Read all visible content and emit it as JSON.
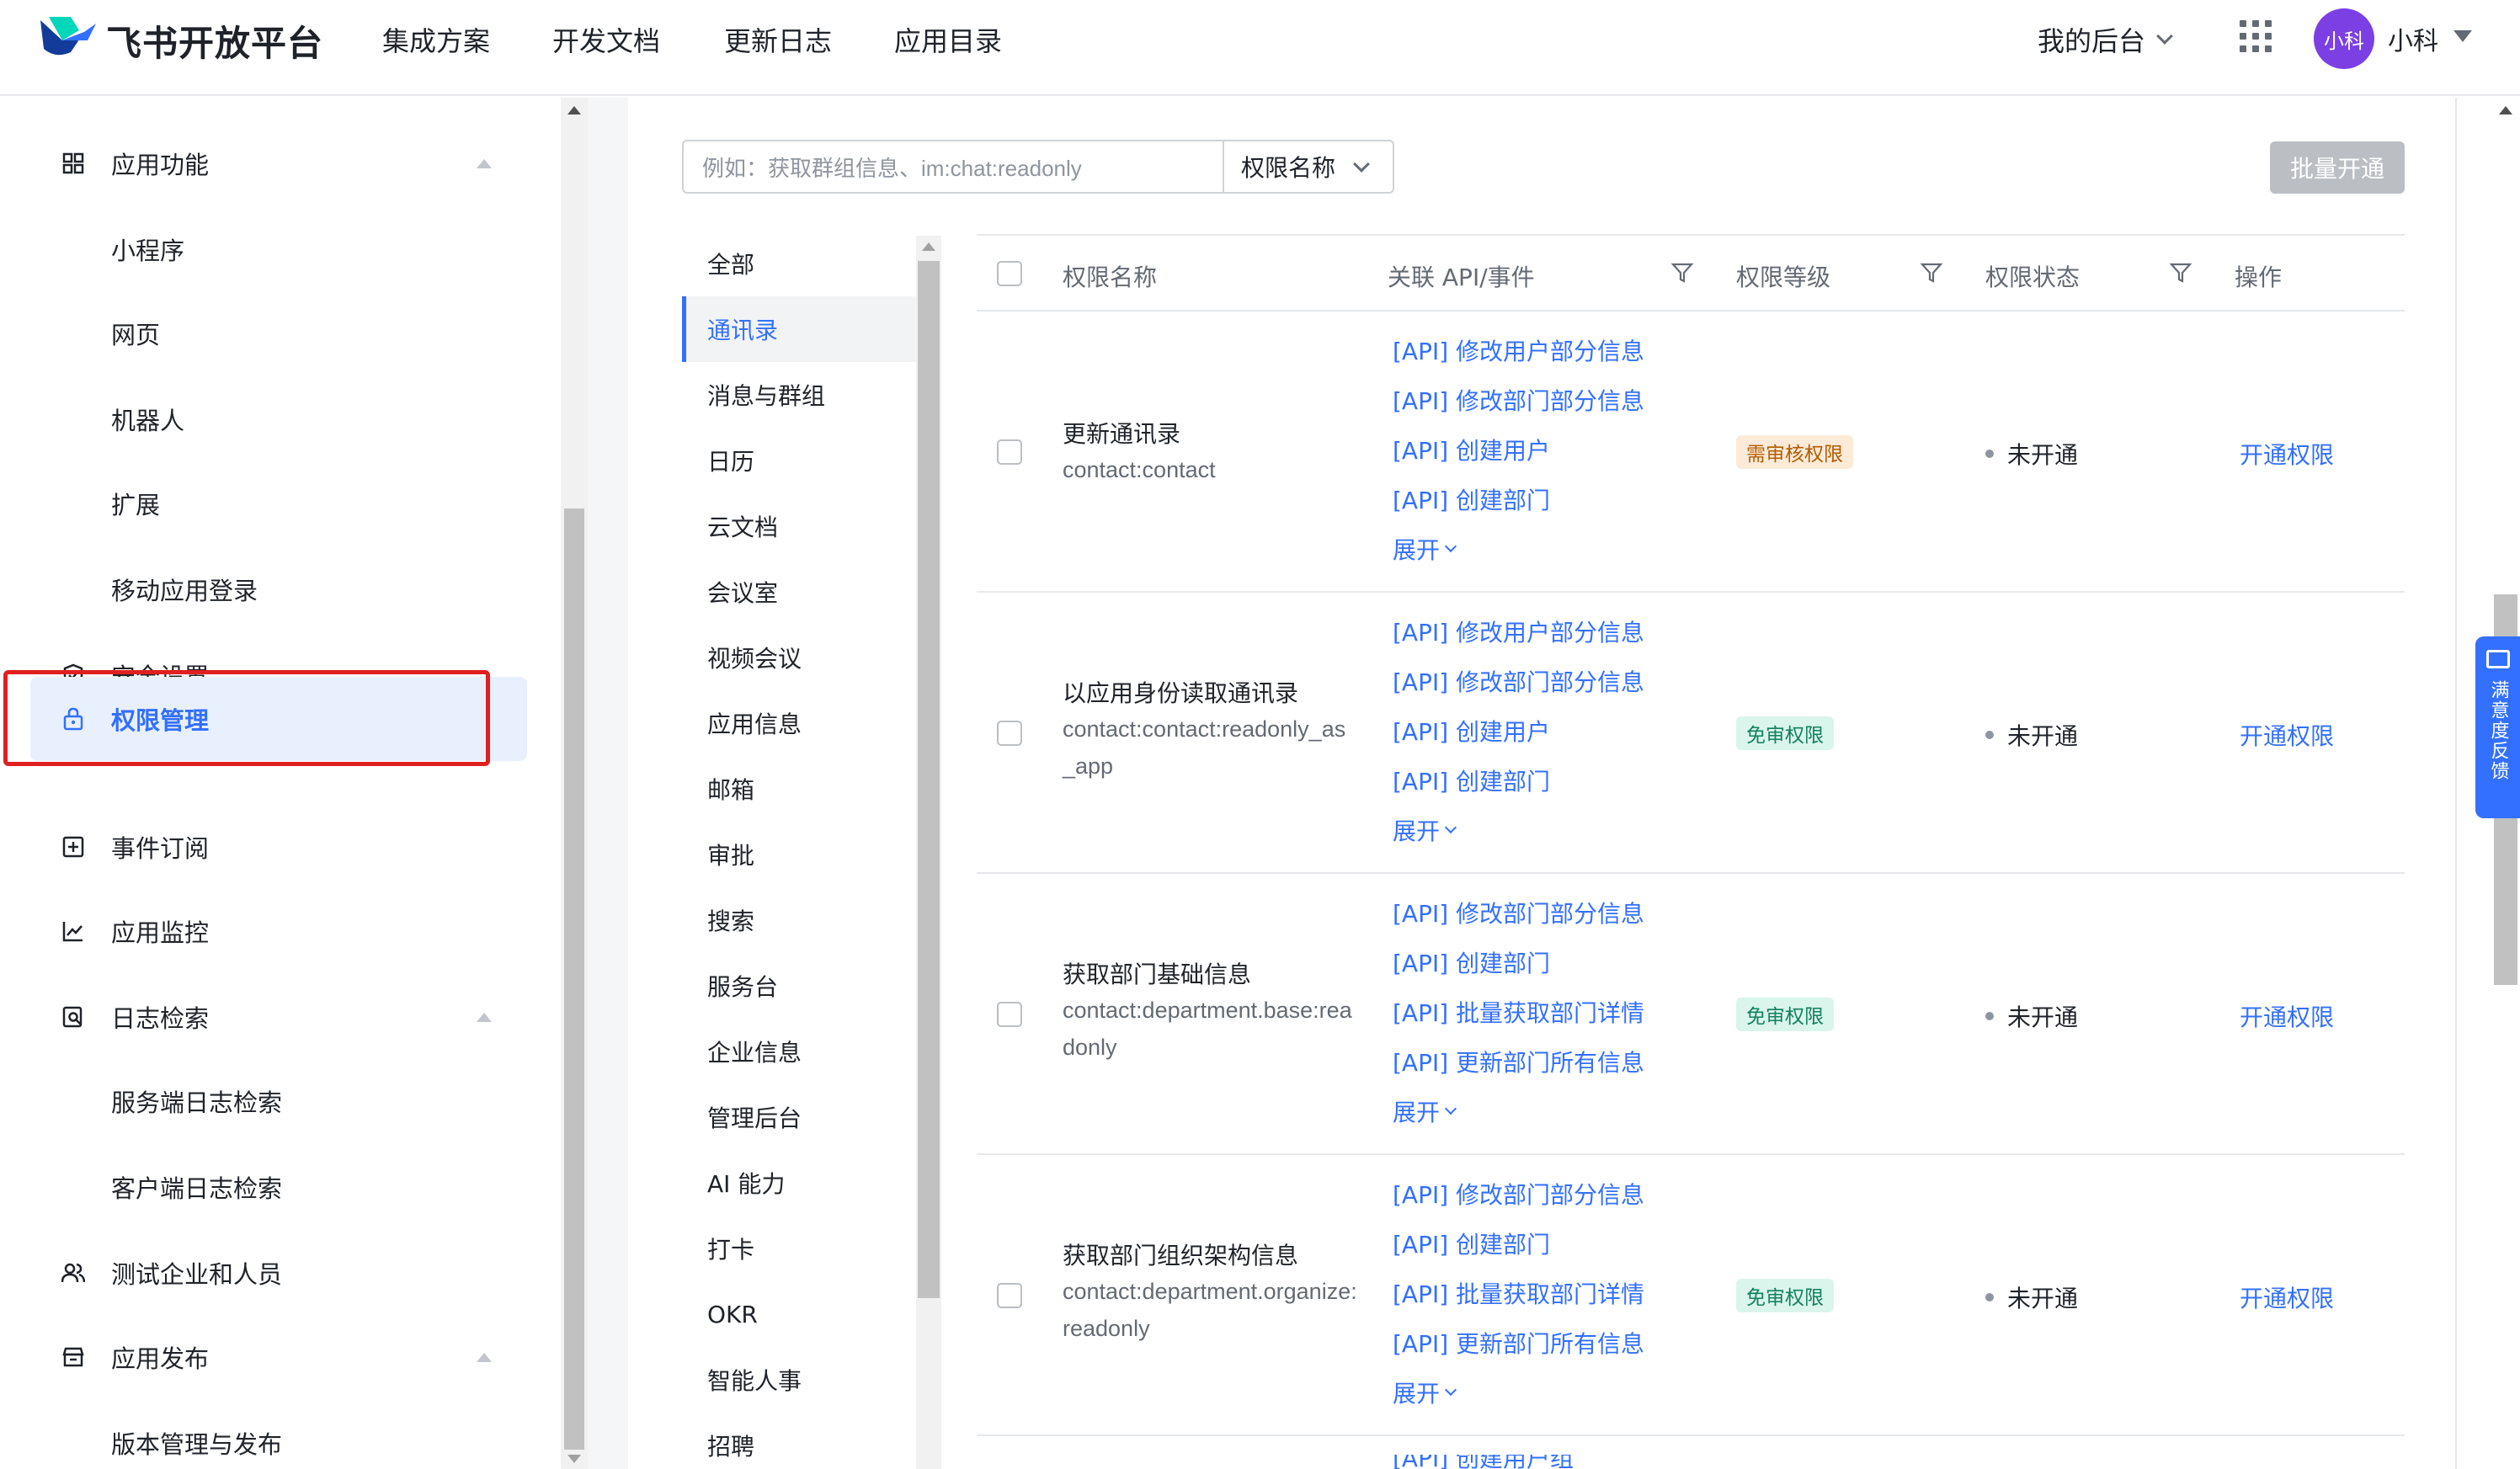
{
  "header": {
    "brand": "飞书开放平台",
    "nav": [
      "集成方案",
      "开发文档",
      "更新日志",
      "应用目录"
    ],
    "my_console": "我的后台",
    "avatar_text": "小科",
    "user_name": "小科"
  },
  "sidebar": {
    "items": [
      {
        "label": "应用功能",
        "icon": "grid-icon",
        "expandable": true
      },
      {
        "label": "小程序",
        "sub": true
      },
      {
        "label": "网页",
        "sub": true
      },
      {
        "label": "机器人",
        "sub": true
      },
      {
        "label": "扩展",
        "sub": true
      },
      {
        "label": "移动应用登录",
        "sub": true
      },
      {
        "label": "安全设置",
        "icon": "shield-icon"
      },
      {
        "label": "权限管理",
        "icon": "lock-icon",
        "active": true
      },
      {
        "label": "事件订阅",
        "icon": "subscribe-icon"
      },
      {
        "label": "应用监控",
        "icon": "chart-icon"
      },
      {
        "label": "日志检索",
        "icon": "log-search-icon",
        "expandable": true
      },
      {
        "label": "服务端日志检索",
        "sub": true
      },
      {
        "label": "客户端日志检索",
        "sub": true
      },
      {
        "label": "测试企业和人员",
        "icon": "users-icon"
      },
      {
        "label": "应用发布",
        "icon": "store-icon",
        "expandable": true
      },
      {
        "label": "版本管理与发布",
        "sub": true
      }
    ]
  },
  "search": {
    "placeholder": "例如：获取群组信息、im:chat:readonly",
    "select_value": "权限名称",
    "batch_button": "批量开通"
  },
  "categories": [
    "全部",
    "通讯录",
    "消息与群组",
    "日历",
    "云文档",
    "会议室",
    "视频会议",
    "应用信息",
    "邮箱",
    "审批",
    "搜索",
    "服务台",
    "企业信息",
    "管理后台",
    "AI 能力",
    "打卡",
    "OKR",
    "智能人事",
    "招聘"
  ],
  "active_category": "通讯录",
  "table": {
    "headers": {
      "name": "权限名称",
      "api": "关联 API/事件",
      "level": "权限等级",
      "status": "权限状态",
      "op": "操作"
    },
    "expand_label": "展开",
    "rows": [
      {
        "name": "更新通讯录",
        "code": "contact:contact",
        "apis": [
          "[API] 修改用户部分信息",
          "[API] 修改部门部分信息",
          "[API] 创建用户",
          "[API] 创建部门"
        ],
        "level": "需审核权限",
        "level_type": "review",
        "status": "未开通",
        "op": "开通权限"
      },
      {
        "name": "以应用身份读取通讯录",
        "code": "contact:contact:readonly_as_app",
        "apis": [
          "[API] 修改用户部分信息",
          "[API] 修改部门部分信息",
          "[API] 创建用户",
          "[API] 创建部门"
        ],
        "level": "免审权限",
        "level_type": "free",
        "status": "未开通",
        "op": "开通权限"
      },
      {
        "name": "获取部门基础信息",
        "code": "contact:department.base:readonly",
        "apis": [
          "[API] 修改部门部分信息",
          "[API] 创建部门",
          "[API] 批量获取部门详情",
          "[API] 更新部门所有信息"
        ],
        "level": "免审权限",
        "level_type": "free",
        "status": "未开通",
        "op": "开通权限"
      },
      {
        "name": "获取部门组织架构信息",
        "code": "contact:department.organize:readonly",
        "apis": [
          "[API] 修改部门部分信息",
          "[API] 创建部门",
          "[API] 批量获取部门详情",
          "[API] 更新部门所有信息"
        ],
        "level": "免审权限",
        "level_type": "free",
        "status": "未开通",
        "op": "开通权限"
      }
    ],
    "partial_next_api": "[API] 创建用户组"
  },
  "feedback": "满意度反馈",
  "colors": {
    "accent": "#3370ff",
    "highlight_box": "#e02020",
    "avatar": "#7b3fe4"
  }
}
